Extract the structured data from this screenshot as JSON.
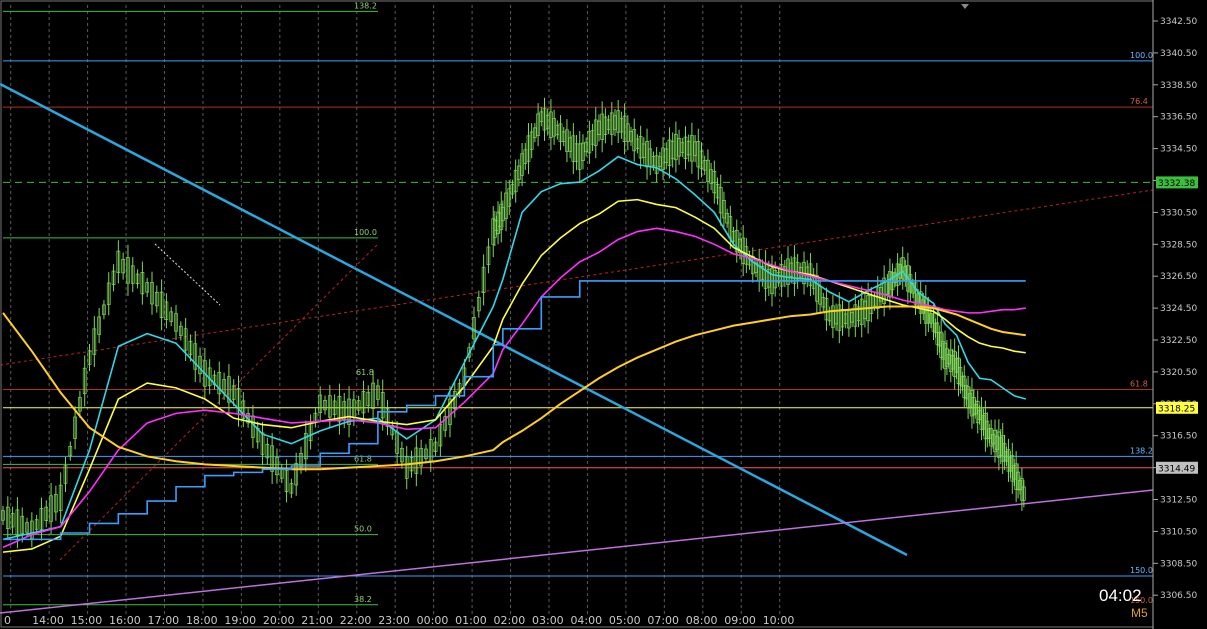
{
  "colors": {
    "background": "#000000",
    "grid": "#5a5a5a",
    "candles": "#7fd85a",
    "ma_fast": "#30d8e8",
    "ma_mid": "#ffff40",
    "ma_slow": "#ff30ff",
    "ma_long": "#ffd020",
    "stepline": "#3aa0ff",
    "fib_green": "#3cbf3c",
    "fib_blue": "#3aa0ff",
    "fib_red": "#b03020",
    "trend_blue": "#2aa8e0",
    "trend_violet": "#c070e0",
    "trend_red_dotted": "#c02020",
    "hline_green_dashed": "#3cbf3c",
    "hline_yellow": "#ffff40",
    "hline_red": "#ff5050"
  },
  "timer": "04:02",
  "timeframe": "M5",
  "chart_data": {
    "type": "line",
    "symbol_type": "candlestick",
    "ylim": [
      3305.4,
      3344.5
    ],
    "y_ticks": [
      "3342.50",
      "3340.50",
      "3338.50",
      "3336.50",
      "3334.50",
      "3332.50",
      "3330.50",
      "3328.50",
      "3326.50",
      "3324.50",
      "3322.50",
      "3320.50",
      "3318.50",
      "3316.50",
      "3314.50",
      "3312.50",
      "3310.50",
      "3308.50",
      "3306.50"
    ],
    "x_ticks": [
      "0",
      "14:00",
      "15:00",
      "16:00",
      "17:00",
      "18:00",
      "19:00",
      "20:00",
      "21:00",
      "22:00",
      "23:00",
      "00:00",
      "01:00",
      "02:00",
      "03:00",
      "04:00",
      "05:00",
      "07:00",
      "08:00",
      "09:00",
      "10:00"
    ],
    "grid": true,
    "price_tags": [
      {
        "label": "3332.38",
        "value": 3332.38,
        "color": "#3cbf3c"
      },
      {
        "label": "3318.25",
        "value": 3318.25,
        "color": "#ffff40"
      },
      {
        "label": "3314.49",
        "value": 3314.49,
        "color": "#c0c0c0"
      }
    ],
    "fib_left": [
      {
        "label": "138.2",
        "value": 3343.1
      },
      {
        "label": "100.0",
        "value": 3328.9
      },
      {
        "label": "61.8",
        "value": 3314.7
      },
      {
        "label": "50.0",
        "value": 3310.3
      },
      {
        "label": "38.2",
        "value": 3305.9
      }
    ],
    "fib_right": [
      {
        "label": "100.0",
        "value": 3340.0
      },
      {
        "label": "76.4",
        "value": 3337.1
      },
      {
        "label": "61.8",
        "value": 3319.4
      },
      {
        "label": "138.2",
        "value": 3315.2
      },
      {
        "label": "150.0",
        "value": 3307.7
      }
    ],
    "fib_extra_labels": [
      "61.8",
      "150.0"
    ],
    "series": [
      {
        "role": "price",
        "x": [
          0,
          0.75,
          1.5,
          2.25,
          3,
          3.75,
          4.5,
          5.25,
          6,
          6.75,
          7.5,
          8.25,
          9,
          9.75,
          10.5,
          11.25,
          12,
          12.75,
          13,
          13.5,
          14,
          14.5,
          15,
          15.5,
          16,
          16.5,
          17,
          17.5,
          18,
          18.5,
          19,
          19.5,
          20,
          20.5,
          21,
          21.5,
          22,
          22.5,
          23,
          23.4,
          23.8,
          24.2,
          24.5,
          24.8,
          25.1,
          25.4,
          25.7,
          26,
          26.3,
          26.6
        ],
        "values": [
          3311.5,
          3310.6,
          3312.6,
          3321.4,
          3327.4,
          3325.8,
          3323.6,
          3320.4,
          3319.2,
          3316.0,
          3313.2,
          3318.5,
          3318.0,
          3319.2,
          3314.5,
          3315.8,
          3320.2,
          3329.3,
          3330.4,
          3333.5,
          3336.5,
          3335.5,
          3334.0,
          3335.8,
          3336.2,
          3334.8,
          3333.5,
          3334.6,
          3334.5,
          3332.4,
          3329.0,
          3327.2,
          3326.2,
          3326.9,
          3326.6,
          3324.0,
          3323.8,
          3324.5,
          3325.8,
          3327.0,
          3325.1,
          3323.6,
          3321.5,
          3320.9,
          3318.9,
          3317.8,
          3316.4,
          3315.7,
          3314.2,
          3312.6
        ]
      },
      {
        "role": "ma_fast",
        "x": [
          0,
          0.75,
          1.5,
          2.25,
          3,
          3.75,
          4.5,
          5.25,
          6,
          6.75,
          7.5,
          8.25,
          9,
          9.75,
          10.5,
          11.25,
          12,
          12.75,
          13,
          13.5,
          14,
          14.5,
          15,
          15.5,
          16,
          16.5,
          17,
          17.5,
          18,
          18.5,
          19,
          19.5,
          20,
          20.5,
          21,
          21.5,
          22,
          22.5,
          23,
          23.4,
          23.8,
          24.2,
          24.5,
          24.8,
          25.1,
          25.4,
          25.7,
          26,
          26.3,
          26.6
        ],
        "values": [
          3310.0,
          3310.4,
          3310.8,
          3315.6,
          3322.1,
          3322.9,
          3322.3,
          3320.4,
          3318.5,
          3316.6,
          3316.0,
          3316.8,
          3317.4,
          3317.6,
          3316.3,
          3317.5,
          3321.1,
          3324.6,
          3326.3,
          3330.5,
          3331.8,
          3332.3,
          3332.4,
          3333.1,
          3334.0,
          3333.5,
          3333.3,
          3332.6,
          3331.6,
          3330.5,
          3328.5,
          3327.4,
          3326.6,
          3326.4,
          3326.3,
          3325.5,
          3324.9,
          3325.6,
          3326.2,
          3326.8,
          3325.5,
          3324.8,
          3323.5,
          3322.8,
          3321.1,
          3320.1,
          3320.0,
          3319.5,
          3319.0,
          3318.8
        ]
      },
      {
        "role": "ma_mid",
        "x": [
          0,
          0.75,
          1.5,
          2.25,
          3,
          3.75,
          4.5,
          5.25,
          6,
          6.75,
          7.5,
          8.25,
          9,
          9.75,
          10.5,
          11.25,
          12,
          12.75,
          13,
          13.5,
          14,
          14.5,
          15,
          15.5,
          16,
          16.5,
          17,
          17.5,
          18,
          18.5,
          19,
          19.5,
          20,
          20.5,
          21,
          21.5,
          22,
          22.5,
          23,
          23.4,
          23.8,
          24.2,
          24.5,
          24.8,
          25.1,
          25.4,
          25.7,
          26,
          26.3,
          26.6
        ],
        "values": [
          3309.2,
          3309.4,
          3310.2,
          3314.4,
          3318.8,
          3319.8,
          3319.5,
          3318.8,
          3317.6,
          3317.2,
          3317.0,
          3317.4,
          3317.7,
          3317.4,
          3317.2,
          3317.5,
          3319.6,
          3322.1,
          3323.8,
          3326.0,
          3327.8,
          3328.9,
          3329.8,
          3330.4,
          3331.2,
          3331.3,
          3331.0,
          3330.8,
          3330.2,
          3329.5,
          3328.3,
          3327.7,
          3327.1,
          3326.8,
          3326.6,
          3326.2,
          3325.8,
          3325.4,
          3325.0,
          3324.7,
          3324.5,
          3324.3,
          3323.8,
          3323.2,
          3322.7,
          3322.3,
          3322.1,
          3322.0,
          3321.8,
          3321.7
        ]
      },
      {
        "role": "ma_slow",
        "x": [
          0,
          0.75,
          1.5,
          2.25,
          3,
          3.75,
          4.5,
          5.25,
          6,
          6.75,
          7.5,
          8.25,
          9,
          9.75,
          10.5,
          11.25,
          12,
          12.75,
          13,
          13.5,
          14,
          14.5,
          15,
          15.5,
          16,
          16.5,
          17,
          17.5,
          18,
          18.5,
          19,
          19.5,
          20,
          20.5,
          21,
          21.5,
          22,
          22.5,
          23,
          23.4,
          23.8,
          24.2,
          24.5,
          24.8,
          25.1,
          25.4,
          25.7,
          26,
          26.3,
          26.6
        ],
        "values": [
          3309.5,
          3310.3,
          3310.8,
          3313.0,
          3315.6,
          3317.3,
          3317.9,
          3318.1,
          3317.9,
          3317.6,
          3317.3,
          3317.4,
          3317.5,
          3317.3,
          3316.9,
          3317.0,
          3318.6,
          3320.4,
          3321.9,
          3323.5,
          3325.2,
          3326.4,
          3327.4,
          3328.0,
          3328.8,
          3329.3,
          3329.5,
          3329.3,
          3329.0,
          3328.5,
          3327.9,
          3327.6,
          3327.2,
          3326.8,
          3326.5,
          3326.2,
          3325.9,
          3325.6,
          3325.3,
          3325.0,
          3324.8,
          3324.6,
          3324.4,
          3324.3,
          3324.2,
          3324.2,
          3324.3,
          3324.4,
          3324.4,
          3324.5
        ]
      },
      {
        "role": "ma_long",
        "x": [
          0,
          0.75,
          1.5,
          2.25,
          3,
          3.75,
          4.5,
          5.25,
          6,
          6.75,
          7.5,
          8.25,
          9,
          9.75,
          10.5,
          11.25,
          12,
          12.75,
          13,
          13.5,
          14,
          14.5,
          15,
          15.5,
          16,
          16.5,
          17,
          17.5,
          18,
          18.5,
          19,
          19.5,
          20,
          20.5,
          21,
          21.5,
          22,
          22.5,
          23,
          23.4,
          23.8,
          24.2,
          24.5,
          24.8,
          25.1,
          25.4,
          25.7,
          26,
          26.3,
          26.6
        ],
        "values": [
          3324.2,
          3321.8,
          3319.2,
          3317.0,
          3315.8,
          3315.2,
          3314.9,
          3314.7,
          3314.6,
          3314.5,
          3314.4,
          3314.4,
          3314.5,
          3314.6,
          3314.7,
          3314.9,
          3315.2,
          3315.6,
          3316.1,
          3316.8,
          3317.6,
          3318.5,
          3319.3,
          3320.1,
          3320.8,
          3321.4,
          3321.9,
          3322.4,
          3322.8,
          3323.1,
          3323.4,
          3323.6,
          3323.8,
          3324.0,
          3324.1,
          3324.3,
          3324.4,
          3324.5,
          3324.6,
          3324.6,
          3324.6,
          3324.5,
          3324.3,
          3324.1,
          3323.8,
          3323.5,
          3323.2,
          3323.0,
          3322.9,
          3322.8
        ]
      },
      {
        "role": "stepline",
        "x": [
          0,
          0.75,
          1.5,
          2.25,
          3,
          3.75,
          4.5,
          5.25,
          6,
          6.75,
          7.5,
          8.25,
          9,
          9.75,
          10.5,
          11.25,
          12,
          12.75,
          13,
          13.5,
          14,
          14.5,
          15,
          15.5,
          16,
          16.5,
          17,
          17.5,
          18,
          18.5,
          19,
          19.5,
          20,
          20.5,
          21,
          21.5,
          22,
          22.5,
          23,
          23.4,
          23.8,
          24.2,
          24.5,
          24.8,
          25.1,
          25.4,
          25.7,
          26,
          26.3,
          26.6
        ],
        "values": [
          3310.0,
          3310.0,
          3310.4,
          3311.0,
          3311.6,
          3312.4,
          3313.3,
          3314.0,
          3314.2,
          3314.4,
          3314.6,
          3315.4,
          3316.0,
          3318.0,
          3318.4,
          3319.0,
          3320.2,
          3322.2,
          3323.2,
          3323.2,
          3325.2,
          3325.2,
          3326.2,
          3326.2,
          3326.2,
          3326.2,
          3326.2,
          3326.2,
          3326.2,
          3326.2,
          3326.2,
          3326.2,
          3326.2,
          3326.2,
          3326.2,
          3326.2,
          3326.2,
          3326.2,
          3326.2,
          3326.2,
          3326.2,
          3326.2,
          3326.2,
          3326.2,
          3326.2,
          3326.2,
          3326.2,
          3326.2,
          3326.2,
          3326.2
        ]
      }
    ]
  }
}
